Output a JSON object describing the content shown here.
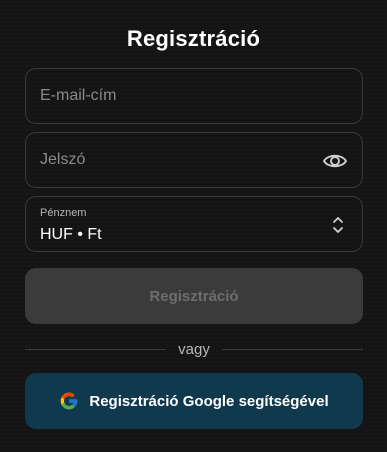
{
  "page": {
    "title": "Regisztráció"
  },
  "form": {
    "email": {
      "placeholder": "E-mail-cím",
      "value": ""
    },
    "password": {
      "placeholder": "Jelszó",
      "value": "",
      "toggle_icon": "eye-icon"
    },
    "currency": {
      "label": "Pénznem",
      "value": "HUF • Ft",
      "icon": "chevron-up-down-icon"
    },
    "submit_label": "Regisztráció",
    "divider_text": "vagy",
    "google_label": "Regisztráció Google segítségével",
    "google_icon": "google-icon"
  },
  "colors": {
    "background": "#141414",
    "field_border": "#3a3a3a",
    "submit_disabled_bg": "#3b3b3b",
    "submit_disabled_text": "#6d6d6d",
    "google_button_bg": "#11394d"
  }
}
